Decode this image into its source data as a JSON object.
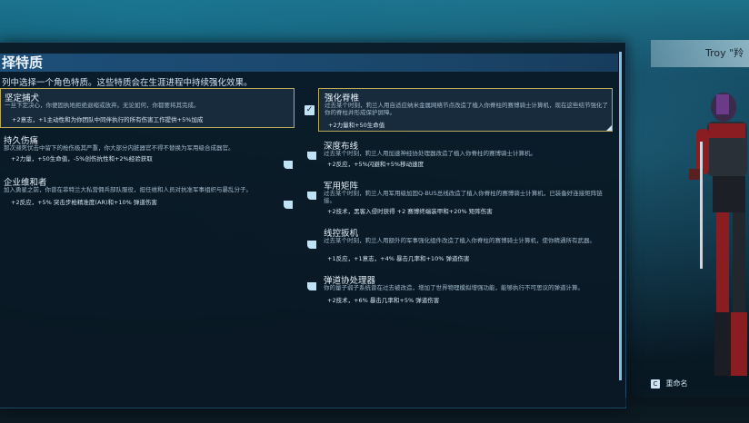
{
  "header": {
    "title": "择特质",
    "subtitle": "列中选择一个角色特质。这些特质会在生涯进程中持续强化效果。"
  },
  "traits_left": [
    {
      "name": "坚定捕犬",
      "desc": "一旦下定决心，你便固执地拒绝退缩或放弃。无论如何，你都要将其完成。",
      "bonus": "+2意志，+1主动性和为你团队中同伴执行的所有伤害工作提供+5%加成",
      "selected": true
    },
    {
      "name": "持久伤痛",
      "desc": "那次濒死伏击中留下的枪伤极其严重，你大部分内脏器官不得不替换为军用级合成器官。",
      "bonus": "+2力量，+50生命值，-5%创伤抗性和+2%经验获取",
      "selected": false
    },
    {
      "name": "企业维和者",
      "desc": "加入勇星之前，你曾在菲特兰大私营佣兵部队服役，担任维和人员对抗准军事组织与暴乱分子。",
      "bonus": "+2反应，+5% 突击步枪精准度(AR)和+10% 弹道伤害",
      "selected": false
    }
  ],
  "traits_right": [
    {
      "name": "强化脊椎",
      "desc": "过去某个时刻，莉兰人用自适应纳米金属网络节点改造了植入你脊柱的赛博骑士计算机，现在这些结节强化了你的脊柱并形成保护屏障。",
      "bonus": "+2力量和+50生命值",
      "selected": true
    },
    {
      "name": "深度布线",
      "desc": "过去某个时刻，莉兰人用加速神经协处理器改造了植入你脊柱的赛博骑士计算机。",
      "bonus": "+2反应，+5%闪避和+5%移动速度",
      "selected": false
    },
    {
      "name": "军用矩阵",
      "desc": "过去某个时刻，莉兰人用军用级加固Q-BUS总线改造了植入你脊柱的赛博骑士计算机，已装备好连接矩阵链接。",
      "bonus": "+2技术，黑客入侵时获得 +2 赛博终端装甲和+20% 矩阵伤害",
      "selected": false
    },
    {
      "name": "线控扳机",
      "desc": "过去某个时刻，莉兰人用额外的军事强化组件改造了植入你脊柱的赛博骑士计算机，使你精通所有武器。",
      "bonus": "+1反应，+1意志，+4% 暴击几率和+10% 弹道伤害",
      "selected": false
    },
    {
      "name": "弹道协处理器",
      "desc": "你的量子弱子系统曾在过去被改造，增加了世界物理模拟增强功能，能够执行不可思议的弹道计算。",
      "bonus": "+2技术，+6% 暴击几率和+5% 弹道伤害",
      "selected": false
    }
  ],
  "character": {
    "name": "Troy \"羚"
  },
  "footer": {
    "rename_key": "C",
    "rename_label": "重命名"
  },
  "colors": {
    "accent": "#1d4f79",
    "selected_border": "#b9a95a",
    "check": "#bfe3f5"
  }
}
